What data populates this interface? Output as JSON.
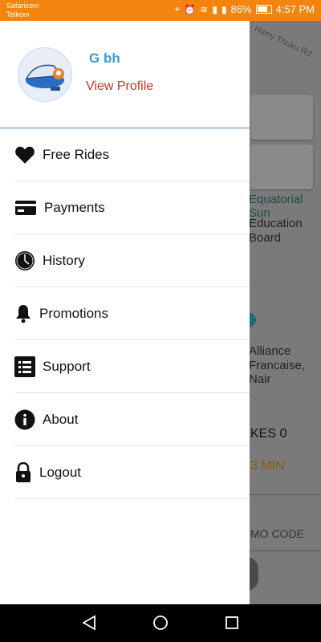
{
  "status_bar": {
    "carrier_1": "Safaricom",
    "carrier_2": "Telkom",
    "battery": "86%",
    "time": "4:57 PM"
  },
  "map": {
    "road_label": "Harry Thuku Rd",
    "place_1": "Equatorial Sun",
    "place_2_line1": "Education",
    "place_2_line2": "Board",
    "place_3_line1": "Alliance",
    "place_3_line2": "Francaise, Nair",
    "bikes_label": "KES 0",
    "eta_label": "3 MIN",
    "promo_label": "MO CODE"
  },
  "profile": {
    "name": "G bh",
    "view_profile": "View Profile"
  },
  "menu": [
    {
      "label": "Free Rides",
      "icon": "heart-icon"
    },
    {
      "label": "Payments",
      "icon": "credit-card-icon"
    },
    {
      "label": "History",
      "icon": "clock-icon"
    },
    {
      "label": "Promotions",
      "icon": "bell-icon"
    },
    {
      "label": "Support",
      "icon": "list-icon"
    },
    {
      "label": "About",
      "icon": "info-icon"
    },
    {
      "label": "Logout",
      "icon": "lock-icon"
    }
  ],
  "colors": {
    "status_bar": "#f5840f",
    "name": "#3d9ad6",
    "view_profile": "#c0392b",
    "divider": "#4a90c8"
  }
}
